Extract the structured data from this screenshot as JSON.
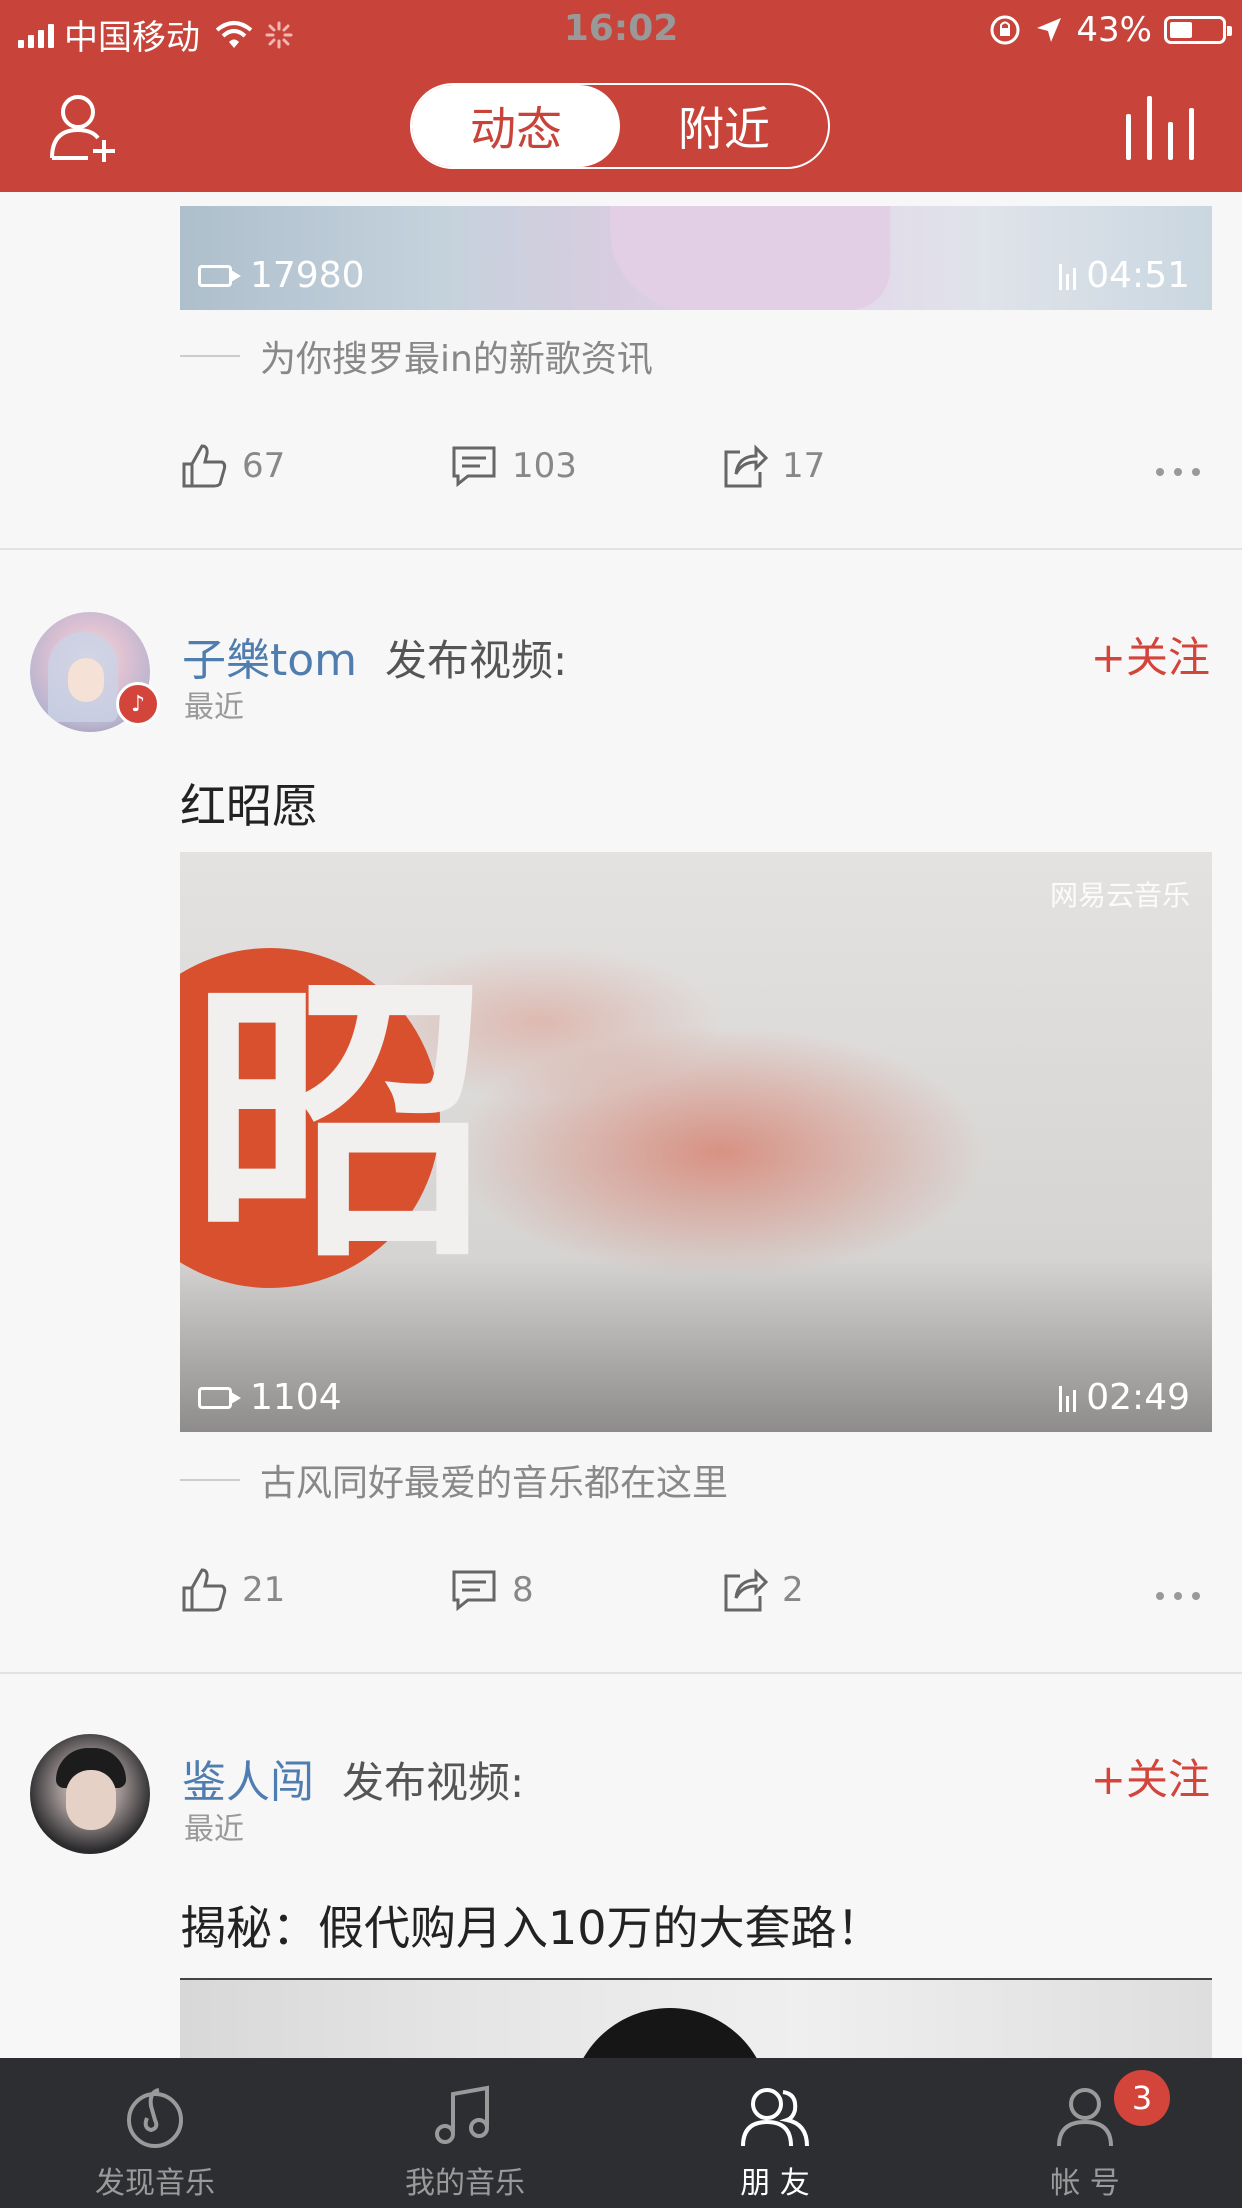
{
  "status_bar": {
    "carrier": "中国移动",
    "time": "16:02",
    "battery": "43%",
    "battery_level": 0.43
  },
  "header": {
    "tabs": [
      {
        "label": "动态",
        "active": true
      },
      {
        "label": "附近",
        "active": false
      }
    ],
    "add_friend_icon": "add-user-icon",
    "right_icon": "equalizer-icon"
  },
  "feed": {
    "post1": {
      "video_views": "17980",
      "video_duration": "04:51",
      "description": "为你搜罗最in的新歌资讯",
      "likes": "67",
      "comments": "103",
      "shares": "17"
    },
    "post2": {
      "username": "子樂tom",
      "action": "发布视频:",
      "time": "最近",
      "follow_label": "+关注",
      "title": "红昭愿",
      "video_watermark": "网易云音乐",
      "video_views": "1104",
      "video_duration": "02:49",
      "description": "古风同好最爱的音乐都在这里",
      "likes": "21",
      "comments": "8",
      "shares": "2"
    },
    "post3": {
      "username": "鉴人闯",
      "action": "发布视频:",
      "time": "最近",
      "follow_label": "+关注",
      "title": "揭秘：假代购月入10万的大套路！"
    }
  },
  "tabbar": {
    "items": [
      {
        "label": "发现音乐",
        "icon": "netease-music-icon",
        "active": false
      },
      {
        "label": "我的音乐",
        "icon": "music-note-icon",
        "active": false
      },
      {
        "label": "朋 友",
        "icon": "friends-icon",
        "active": true
      },
      {
        "label": "帐 号",
        "icon": "user-icon",
        "active": false,
        "badge": "3"
      }
    ]
  },
  "colors": {
    "brand_red": "#c8443a",
    "username_blue": "#507daf",
    "tabbar_bg": "#2d2e31"
  }
}
